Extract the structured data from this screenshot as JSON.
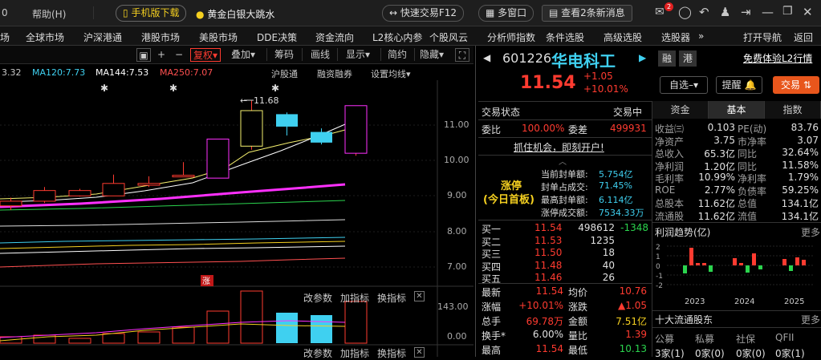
{
  "top": {
    "items": [
      "场",
      "全球市场",
      "沪深港通",
      "港股市场",
      "美股市场",
      "DDE决策",
      "资金流向",
      "L2核心内参",
      "个股风云",
      "分析师指数",
      "条件选股",
      "高级选股",
      "选股器"
    ],
    "partial_left": "0",
    "help": "帮助(H)",
    "mobile_download": "手机版下载",
    "promo_text": "黄金白银大跳水",
    "quick_trade": "快速交易F12",
    "multi_window": "多窗口",
    "news": "查看2条新消息",
    "mail_badge": "2",
    "open_nav": "打开导航",
    "back": "返回",
    "more_arrow": "»"
  },
  "toolbar": {
    "minus": "−",
    "plus": "+",
    "fuquan": "复权",
    "overlay": "叠加",
    "chips": "筹码",
    "draw": "画线",
    "show": "显示",
    "simple": "简约",
    "hide": "隐藏"
  },
  "ma_row": {
    "first": "3.32",
    "ma120": "MA120:7.73",
    "ma144": "MA144:7.53",
    "ma250": "MA250:7.07",
    "hgt": "沪股通",
    "rzrq": "融资融券",
    "settings": "设置均线"
  },
  "chart": {
    "yticks": [
      "11.00",
      "10.00",
      "9.00",
      "8.00",
      "7.00"
    ],
    "peak_label": "11.68",
    "limit_badge": "涨",
    "sub_header": [
      "改参数",
      "加指标",
      "换指标"
    ],
    "sub_yticks": [
      "143.00",
      "0.00"
    ],
    "sub2_header": [
      "改参数",
      "加指标",
      "换指标"
    ],
    "candles": [
      {
        "o": 8.72,
        "c": 8.85,
        "h": 8.95,
        "l": 8.6
      },
      {
        "o": 8.85,
        "c": 9.15,
        "h": 9.25,
        "l": 8.8
      },
      {
        "o": 9.0,
        "c": 9.15,
        "h": 9.2,
        "l": 8.98
      },
      {
        "o": 9.0,
        "c": 9.35,
        "h": 9.6,
        "l": 9.0
      },
      {
        "o": 9.3,
        "c": 9.35,
        "h": 9.55,
        "l": 9.25
      },
      {
        "o": 9.55,
        "c": 9.58,
        "h": 9.95,
        "l": 9.55
      },
      {
        "o": 9.5,
        "c": 10.6,
        "h": 10.6,
        "l": 9.5
      },
      {
        "o": 10.4,
        "c": 11.4,
        "h": 11.68,
        "l": 10.3
      },
      {
        "o": 11.3,
        "c": 10.95,
        "h": 11.35,
        "l": 10.7
      },
      {
        "o": 10.8,
        "c": 10.5,
        "h": 10.9,
        "l": 10.45
      },
      {
        "o": 10.2,
        "c": 11.54,
        "h": 11.54,
        "l": 10.13
      }
    ]
  },
  "stock": {
    "code": "601226",
    "name": "华电科工",
    "tag1": "融",
    "tag2": "港",
    "free_l2": "免费体验L2行情",
    "price": "11.54",
    "change": "+1.05",
    "pct": "+10.01%",
    "watchlist": "自选",
    "remind": "提醒",
    "trade": "交易"
  },
  "status": {
    "label": "交易状态",
    "value": "交易中",
    "weibi_label": "委比",
    "weibi": "100.00%",
    "weicha_label": "委差",
    "weicha": "499931",
    "promo": "抓住机会，即刻开户!",
    "limit_title": "涨停",
    "limit_sub": "(今日首板)",
    "limit_rows": [
      {
        "label": "当前封单额:",
        "value": "5.754亿"
      },
      {
        "label": "封单占成交:",
        "value": "71.45%"
      },
      {
        "label": "最高封单额:",
        "value": "6.114亿"
      },
      {
        "label": "涨停成交额:",
        "value": "7534.33万"
      }
    ],
    "bids": [
      {
        "label": "买一",
        "price": "11.54",
        "vol": "498612",
        "chg": "-1348"
      },
      {
        "label": "买二",
        "price": "11.53",
        "vol": "1235",
        "chg": ""
      },
      {
        "label": "买三",
        "price": "11.50",
        "vol": "18",
        "chg": ""
      },
      {
        "label": "买四",
        "price": "11.48",
        "vol": "40",
        "chg": ""
      },
      {
        "label": "买五",
        "price": "11.46",
        "vol": "26",
        "chg": ""
      }
    ],
    "stats": [
      {
        "l1": "最新",
        "v1": "11.54",
        "l2": "均价",
        "v2": "10.76"
      },
      {
        "l1": "涨幅",
        "v1": "+10.01%",
        "l2": "涨跌",
        "v2": "▲1.05"
      },
      {
        "l1": "总手",
        "v1": "69.78万",
        "l2": "金额",
        "v2": "7.51亿"
      },
      {
        "l1": "换手*",
        "v1": "6.00%",
        "l2": "量比",
        "v2": "1.39"
      },
      {
        "l1": "最高",
        "v1": "11.54",
        "l2": "最低",
        "v2": "10.13"
      }
    ]
  },
  "fund": {
    "tabs": [
      "资金",
      "基本",
      "指数"
    ],
    "rows": [
      {
        "l1": "收益㈢",
        "v1": "0.103",
        "l2": "PE(动)",
        "v2": "83.76"
      },
      {
        "l1": "净资产",
        "v1": "3.75",
        "l2": "市净率",
        "v2": "3.07"
      },
      {
        "l1": "总收入",
        "v1": "65.3亿",
        "l2": "同比",
        "v2": "32.64%"
      },
      {
        "l1": "净利润",
        "v1": "1.20亿",
        "l2": "同比",
        "v2": "11.58%"
      },
      {
        "l1": "毛利率",
        "v1": "10.99%",
        "l2": "净利率",
        "v2": "1.79%"
      },
      {
        "l1": "ROE",
        "v1": "2.77%",
        "l2": "负债率",
        "v2": "59.25%"
      },
      {
        "l1": "总股本",
        "v1": "11.62亿",
        "l2": "总值",
        "v2": "134.1亿"
      },
      {
        "l1": "流通股",
        "v1": "11.62亿",
        "l2": "流值",
        "v2": "134.1亿"
      }
    ],
    "profit_title": "利润趋势(亿)",
    "more": "更多",
    "profit_yticks": [
      "2",
      "1",
      "0",
      "-1",
      "-2"
    ],
    "profit_years": [
      "2023",
      "2024",
      "2025"
    ],
    "profit_bars": [
      -1.0,
      2.2,
      0.3,
      0.3,
      -0.8,
      0.9,
      0.3,
      -0.9,
      1.5,
      -0.5,
      0.8,
      -0.7,
      1.0,
      0.7
    ],
    "holders_title": "十大流通股东",
    "holders_more": "更多",
    "holder_types": [
      "公募",
      "私募",
      "社保",
      "QFII"
    ],
    "holder_counts": [
      "3家(1)",
      "0家(0)",
      "0家(0)",
      "0家(1)"
    ]
  }
}
